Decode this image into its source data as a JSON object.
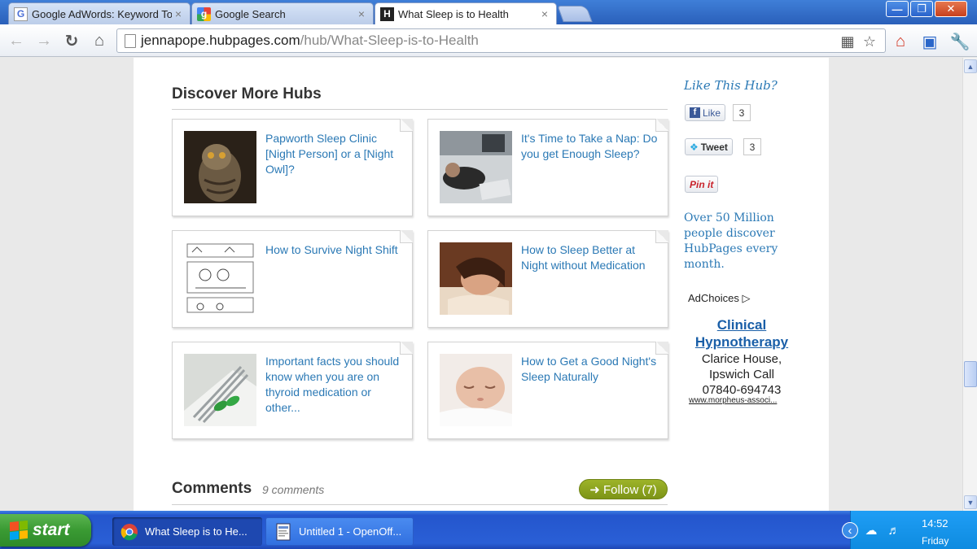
{
  "browser": {
    "tabs": [
      {
        "title": "Google AdWords: Keyword To",
        "favicon": "G",
        "active": false
      },
      {
        "title": "Google Search",
        "favicon": "g",
        "active": false
      },
      {
        "title": "What Sleep is to Health",
        "favicon": "H",
        "active": true
      }
    ],
    "close_glyph": "×",
    "window": {
      "minimize": "—",
      "restore": "❐",
      "close": "✕"
    },
    "url_host": "jennapope.hubpages.com",
    "url_path": "/hub/What-Sleep-is-to-Health"
  },
  "page": {
    "discover_title": "Discover More Hubs",
    "hubs": [
      {
        "title": "Papworth Sleep Clinic [Night Person] or a [Night Owl]?",
        "thumb": "owl-photo"
      },
      {
        "title": "It's Time to Take a Nap: Do you get Enough Sleep?",
        "thumb": "nap-photo"
      },
      {
        "title": "How to Survive Night Shift",
        "thumb": "comic-sketch"
      },
      {
        "title": "How to Sleep Better at Night without Medication",
        "thumb": "sleeping-woman-photo"
      },
      {
        "title": "Important facts you should know when you are on thyroid medication or other...",
        "thumb": "pills-photo"
      },
      {
        "title": "How to Get a Good Night's Sleep Naturally",
        "thumb": "sleeping-baby-photo"
      }
    ],
    "comments_title": "Comments",
    "comments_count": "9 comments",
    "follow_label": "➜ Follow (7)"
  },
  "sidebar": {
    "like_heading": "Like This Hub?",
    "fb_label": "Like",
    "fb_count": "3",
    "tweet_label": "Tweet",
    "tweet_count": "3",
    "pin_label": "Pin it",
    "promo": "Over 50 Million people discover HubPages every month.",
    "adchoices": "AdChoices",
    "ad_title": "Clinical Hypnotherapy",
    "ad_body": "Clarice House, Ipswich Call 07840-694743",
    "ad_url": "www.morpheus-associ..."
  },
  "taskbar": {
    "start": "start",
    "tasks": [
      {
        "label": "What Sleep is to He...",
        "active": true
      },
      {
        "label": "Untitled 1 - OpenOff...",
        "active": false
      }
    ],
    "time": "14:52",
    "day": "Friday"
  },
  "colors": {
    "link_blue": "#2b79b5",
    "follow_green": "#8aa31f",
    "xp_blue": "#2a5fd6",
    "xp_green": "#3a9a33"
  }
}
